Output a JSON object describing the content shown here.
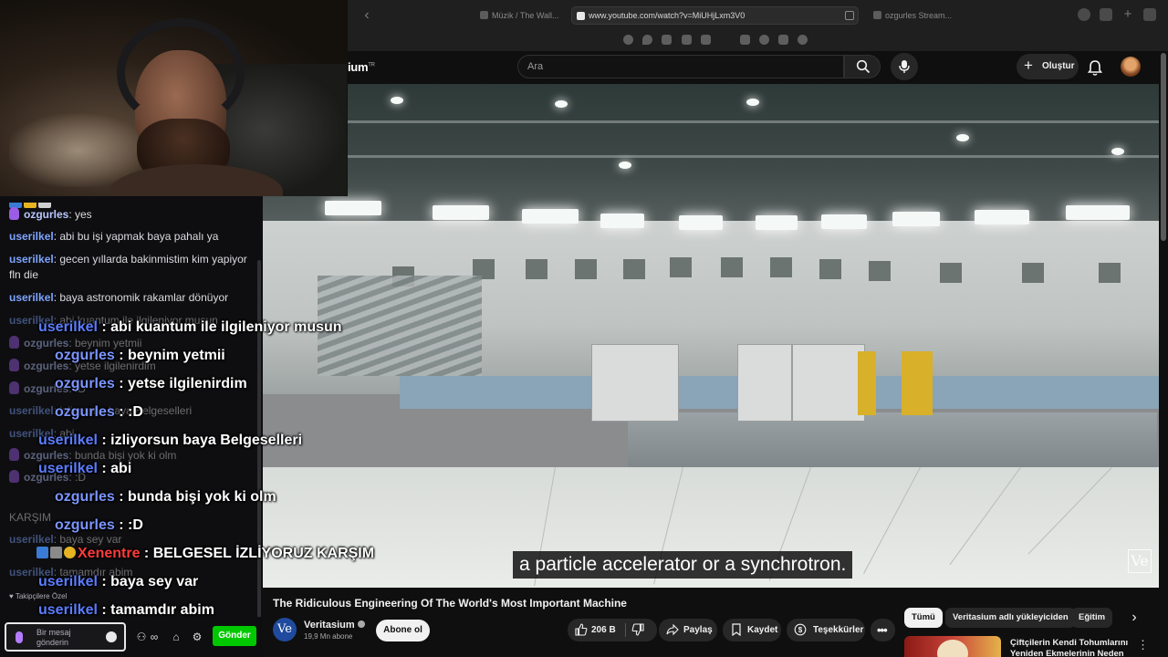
{
  "browser": {
    "tabs": [
      {
        "label": "Müzik / The Wall..."
      },
      {
        "label": "www.youtube.com/watch?v=MiUHjLxm3V0"
      },
      {
        "label": "ozgurles Stream..."
      }
    ]
  },
  "youtube": {
    "logo_partial": "ium",
    "search_placeholder": "Ara",
    "create_label": "Oluştur"
  },
  "video": {
    "subtitle": "a particle accelerator or a synchrotron.",
    "watermark": "Ve",
    "title": "The Ridiculous Engineering Of The World's Most Important Machine",
    "channel": {
      "avatar_text": "Ve",
      "name": "Veritasium",
      "subscribers": "19,9 Mn abone",
      "subscribe_label": "Abone ol"
    },
    "actions": {
      "likes": "206 B",
      "share": "Paylaş",
      "save": "Kaydet",
      "thanks": "Teşekkürler"
    }
  },
  "recommendations": {
    "chips": [
      "Tümü",
      "Veritasium adlı yükleyiciden",
      "Eğitim"
    ],
    "first_title": "Çiftçilerin Kendi Tohumlarını Yeniden Ekmelerinin Neden"
  },
  "chat": {
    "messages": [
      {
        "user": "ozgurles",
        "text": ": yes"
      },
      {
        "user": "userilkel",
        "text": ": abi bu işi yapmak baya pahalı ya"
      },
      {
        "user": "userilkel",
        "text": ": gecen yıllarda bakinmistim kim yapiyor fln die"
      },
      {
        "user": "userilkel",
        "text": ": baya astronomik rakamlar dönüyor"
      }
    ],
    "faded": [
      {
        "user": "userilkel",
        "text": ": abi kuantum ile ilgileniyor musun"
      },
      {
        "user": "ozgurles",
        "text": ": beynim yetmii"
      },
      {
        "user": "ozgurles",
        "text": ": yetse ilgilenirdim"
      },
      {
        "user": "ozgurles",
        "text": ": :D"
      },
      {
        "user": "userilkel",
        "text": ": izliyorsun baya Belgeselleri"
      },
      {
        "user": "userilkel",
        "text": ": abi"
      },
      {
        "user": "ozgurles",
        "text": ": bunda bişi yok ki olm"
      },
      {
        "user": "ozgurles",
        "text": ": :D"
      },
      {
        "user": "",
        "text": "KARŞIM"
      },
      {
        "user": "userilkel",
        "text": ": baya sey var"
      },
      {
        "user": "userilkel",
        "text": ": tamamdır abim"
      }
    ],
    "follower_note": "Takipçilere Özel",
    "input_placeholder": "Bir mesaj gönderin",
    "send_label": "Gönder"
  },
  "overlay": [
    {
      "user": "userilkel",
      "text": " : abi kuantum ile ilgileniyor musun"
    },
    {
      "user": "ozgurles",
      "text": " : beynim yetmii"
    },
    {
      "user": "ozgurles",
      "text": " : yetse ilgilenirdim"
    },
    {
      "user": "ozgurles",
      "text": " : :D"
    },
    {
      "user": "userilkel",
      "text": " : izliyorsun baya Belgeselleri"
    },
    {
      "user": "userilkel",
      "text": " : abi"
    },
    {
      "user": "ozgurles",
      "text": " : bunda bişi yok ki olm"
    },
    {
      "user": "ozgurles",
      "text": " : :D"
    },
    {
      "user": "Xenentre",
      "text": " : BELGESEL İZLİYORUZ KARŞIM"
    },
    {
      "user": "userilkel",
      "text": " : baya sey var"
    },
    {
      "user": "userilkel",
      "text": " : tamamdır abim"
    }
  ]
}
